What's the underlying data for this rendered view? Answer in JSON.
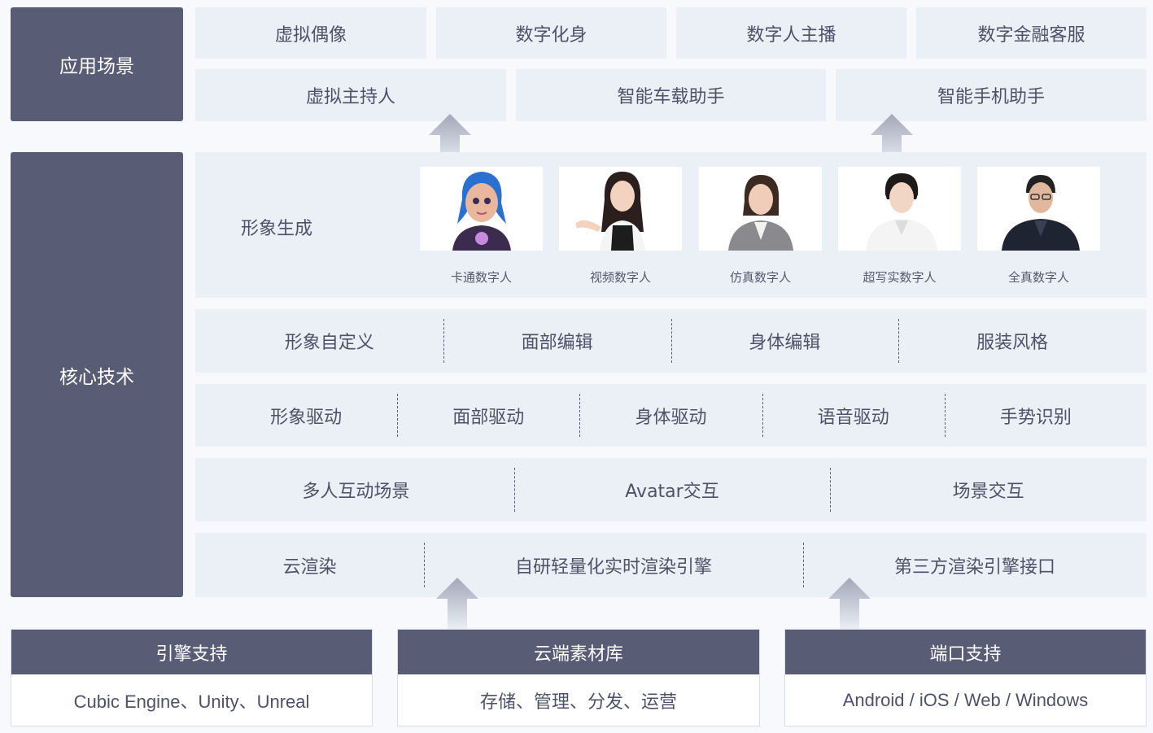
{
  "left_labels": {
    "scenarios": "应用场景",
    "core_tech": "核心技术"
  },
  "scenarios": {
    "row1": [
      "虚拟偶像",
      "数字化身",
      "数字人主播",
      "数字金融客服"
    ],
    "row2": [
      "虚拟主持人",
      "智能车载助手",
      "智能手机助手"
    ]
  },
  "avatar_generation": {
    "title": "形象生成",
    "avatars": [
      {
        "label": "卡通数字人",
        "icon": "cartoon-avatar-icon"
      },
      {
        "label": "视频数字人",
        "icon": "video-avatar-icon"
      },
      {
        "label": "仿真数字人",
        "icon": "simulated-avatar-icon"
      },
      {
        "label": "超写实数字人",
        "icon": "hyperreal-avatar-icon"
      },
      {
        "label": "全真数字人",
        "icon": "fullreal-avatar-icon"
      }
    ]
  },
  "tech_rows": {
    "customize": [
      "形象自定义",
      "面部编辑",
      "身体编辑",
      "服装风格"
    ],
    "drive": [
      "形象驱动",
      "面部驱动",
      "身体驱动",
      "语音驱动",
      "手势识别"
    ],
    "interaction": [
      "多人互动场景",
      "Avatar交互",
      "场景交互"
    ],
    "render": [
      "云渲染",
      "自研轻量化实时渲染引擎",
      "第三方渲染引擎接口"
    ]
  },
  "support": [
    {
      "title": "引擎支持",
      "content": "Cubic Engine、Unity、Unreal"
    },
    {
      "title": "云端素材库",
      "content": "存储、管理、分发、运营"
    },
    {
      "title": "端口支持",
      "content": "Android / iOS / Web / Windows"
    }
  ],
  "colors": {
    "dark_block": "#585c74",
    "light_block": "#ebeff6",
    "background": "#f7f9fc",
    "arrow": "#a9adbd"
  }
}
